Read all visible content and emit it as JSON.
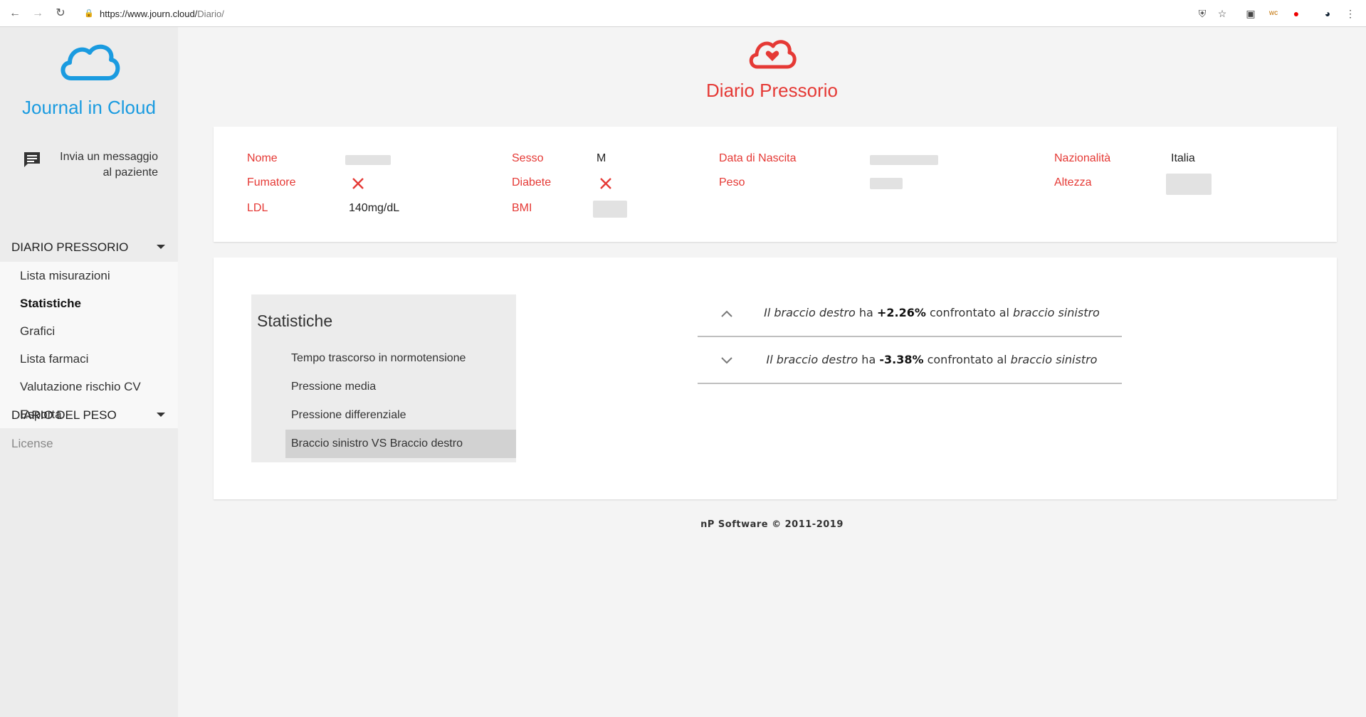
{
  "browser": {
    "url_host": "https://www.journ.cloud/",
    "url_path": "Diario/"
  },
  "sidebar": {
    "brand": "Journal in Cloud",
    "message_line1": "Invia un messaggio",
    "message_line2": "al paziente",
    "section1": "DIARIO PRESSORIO",
    "items": [
      {
        "label": "Lista misurazioni"
      },
      {
        "label": "Statistiche"
      },
      {
        "label": "Grafici"
      },
      {
        "label": "Lista farmaci"
      },
      {
        "label": "Valutazione rischio CV"
      },
      {
        "label": "Esporta"
      }
    ],
    "section2": "DIARIO DEL PESO",
    "license": "License"
  },
  "header": {
    "title": "Diario Pressorio"
  },
  "patient": {
    "nome_label": "Nome",
    "sesso_label": "Sesso",
    "sesso_value": "M",
    "nascita_label": "Data di Nascita",
    "nazionalita_label": "Nazionalità",
    "nazionalita_value": "Italia",
    "fumatore_label": "Fumatore",
    "diabete_label": "Diabete",
    "peso_label": "Peso",
    "altezza_label": "Altezza",
    "ldl_label": "LDL",
    "ldl_value": "140mg/dL",
    "bmi_label": "BMI"
  },
  "stats": {
    "title": "Statistiche",
    "items": [
      {
        "label": "Tempo trascorso in normotensione"
      },
      {
        "label": "Pressione media"
      },
      {
        "label": "Pressione differenziale"
      },
      {
        "label": "Braccio sinistro VS Braccio destro"
      }
    ],
    "rows": [
      {
        "a": "Il braccio destro",
        "b": " ha ",
        "pct": "+2.26%",
        "c": " confrontato al ",
        "d": "braccio sinistro"
      },
      {
        "a": "Il braccio destro",
        "b": " ha ",
        "pct": "-3.38%",
        "c": " confrontato al ",
        "d": "braccio sinistro"
      }
    ]
  },
  "footer": "nP Software © 2011-2019",
  "colors": {
    "accent": "#e53935",
    "brand": "#1a9be0"
  }
}
